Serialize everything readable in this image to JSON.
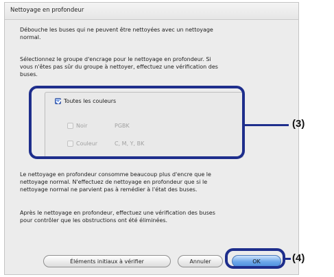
{
  "dialog": {
    "title": "Nettoyage en profondeur",
    "intro": "Débouche les buses qui ne peuvent être nettoyées avec un nettoyage\nnormal.",
    "select_instruction": "Sélectionnez le groupe d'encrage pour le nettoyage en profondeur. Si\nvous n'êtes pas sûr du groupe à nettoyer, effectuez une vérification des\nbuses.",
    "ink_group": {
      "all_colors_label": "Toutes les couleurs",
      "all_colors_checked": true,
      "options": [
        {
          "label": "Noir",
          "value": "PGBK",
          "checked": false,
          "enabled": false
        },
        {
          "label": "Couleur",
          "value": "C, M, Y, BK",
          "checked": false,
          "enabled": false
        }
      ]
    },
    "warning": "Le nettoyage en profondeur consomme beaucoup plus d'encre que le\nnettoyage normal. N'effectuez de nettoyage en profondeur que si le\nnettoyage normal ne parvient pas à remédier à l'état des buses.",
    "after_note": "Après le nettoyage en profondeur, effectuez une vérification des buses\npour contrôler que les obstructions ont été éliminées.",
    "buttons": {
      "initial_items": "Éléments initiaux à vérifier",
      "cancel": "Annuler",
      "ok": "OK"
    }
  },
  "callouts": {
    "group": "(3)",
    "ok": "(4)"
  },
  "colors": {
    "callout": "#1e2e8c",
    "ok_button": "#6aa6ea"
  }
}
